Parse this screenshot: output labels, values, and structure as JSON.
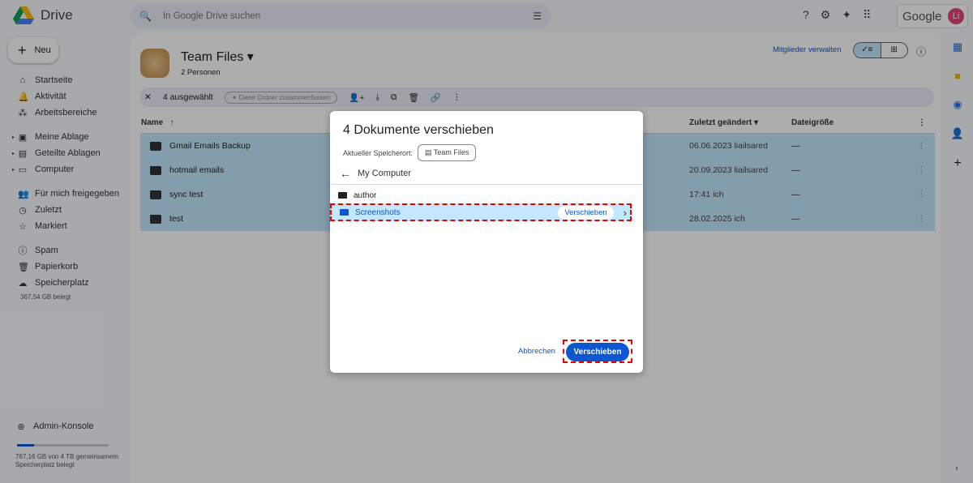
{
  "app": {
    "name": "Drive"
  },
  "search": {
    "placeholder": "In Google Drive suchen"
  },
  "header": {
    "brand": "Google",
    "avatar": "Li"
  },
  "sidebar": {
    "new_label": "Neu",
    "items": [
      {
        "label": "Startseite",
        "icon": "⌂"
      },
      {
        "label": "Aktivität",
        "icon": "🔔"
      },
      {
        "label": "Arbeitsbereiche",
        "icon": "⁂"
      },
      {
        "label": "Meine Ablage",
        "icon": "▣"
      },
      {
        "label": "Geteilte Ablagen",
        "icon": "▤"
      },
      {
        "label": "Computer",
        "icon": "▭"
      },
      {
        "label": "Für mich freigegeben",
        "icon": "👥"
      },
      {
        "label": "Zuletzt",
        "icon": "◷"
      },
      {
        "label": "Markiert",
        "icon": "☆"
      },
      {
        "label": "Spam",
        "icon": "ⓘ"
      },
      {
        "label": "Papierkorb",
        "icon": "🗑"
      },
      {
        "label": "Speicherplatz",
        "icon": "☁"
      }
    ],
    "storage_used": "367,54 GB belegt",
    "admin": "Admin-Konsole",
    "shared_storage": "767,16 GB von 4 TB gemeinsamem Speicherplatz belegt",
    "shared_storage_fraction": 0.19
  },
  "drive": {
    "title": "Team Files",
    "members": "2 Personen",
    "manage": "Mitglieder verwalten"
  },
  "selection": {
    "count": "4 ausgewählt",
    "summarize": "Diese Ordner zusammenfassen"
  },
  "table": {
    "headers": {
      "name": "Name",
      "modified": "Zuletzt geändert",
      "size": "Dateigröße"
    },
    "rows": [
      {
        "name": "Gmail Emails Backup",
        "modified": "06.06.2023 liailsared",
        "size": "—"
      },
      {
        "name": "hotmail emails",
        "modified": "20.09.2023 liailsared",
        "size": "—"
      },
      {
        "name": "sync test",
        "modified": "17:41 ich",
        "size": "—"
      },
      {
        "name": "test",
        "modified": "28.02.2025 ich",
        "size": "—"
      }
    ]
  },
  "dialog": {
    "title": "4 Dokumente verschieben",
    "location_label": "Aktueller Speicherort:",
    "location": "Team Files",
    "folder": "My Computer",
    "items": [
      {
        "name": "author"
      },
      {
        "name": "Screenshots",
        "action": "Verschieben"
      }
    ],
    "cancel": "Abbrechen",
    "confirm": "Verschieben"
  },
  "colors": {
    "accent": "#0b57d0",
    "selected": "#c2e7ff",
    "highlight": "#ee0000"
  }
}
